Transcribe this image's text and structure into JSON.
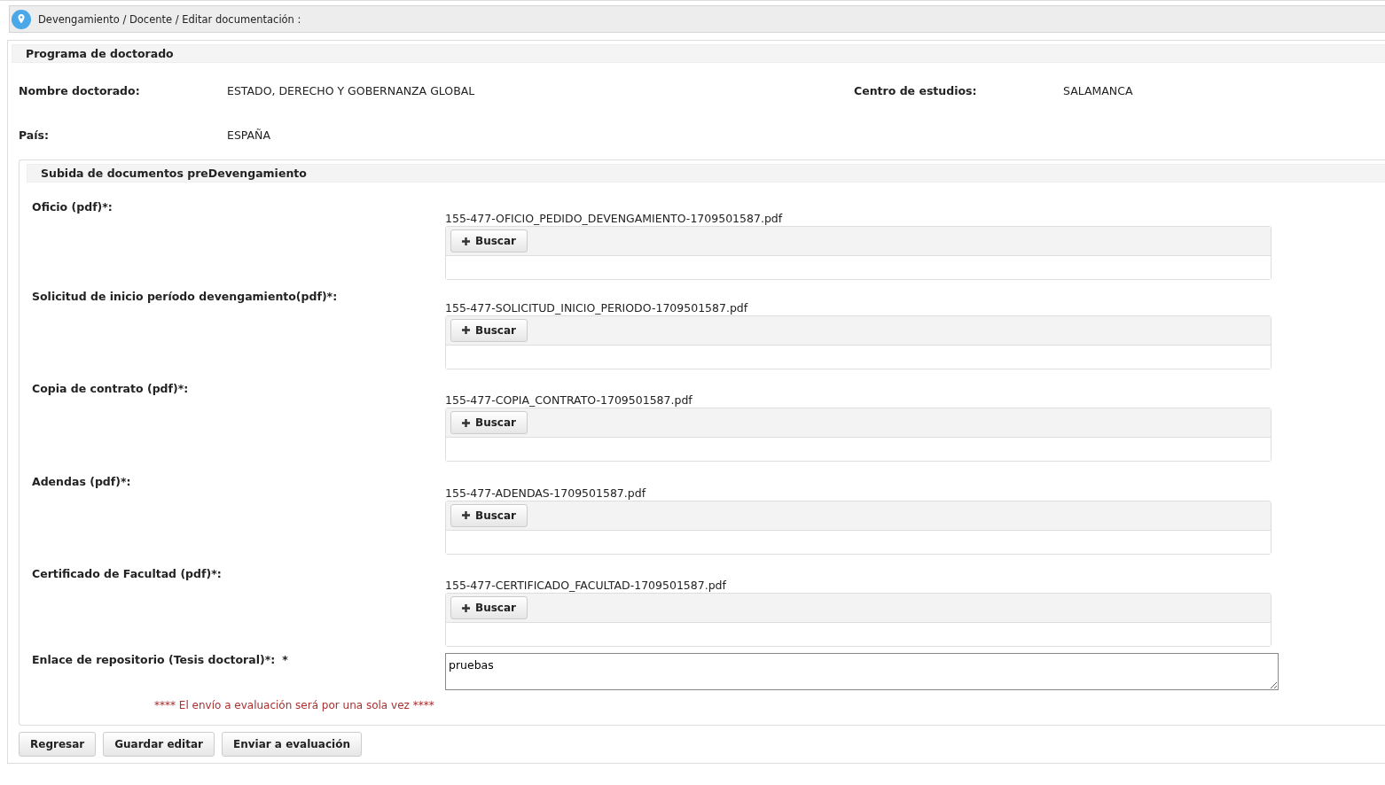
{
  "breadcrumb": "Devengamiento / Docente / Editar documentación :",
  "program_panel": {
    "title": "Programa de doctorado",
    "fields": [
      {
        "label": "Nombre doctorado:",
        "value": "ESTADO, DERECHO Y GOBERNANZA GLOBAL"
      },
      {
        "label": "Centro de estudios:",
        "value": "SALAMANCA"
      },
      {
        "label": "País:",
        "value": "ESPAÑA"
      }
    ]
  },
  "upload_panel": {
    "title": "Subida de documentos preDevengamiento",
    "documents": [
      {
        "label": "Oficio (pdf)*:",
        "file": "155-477-OFICIO_PEDIDO_DEVENGAMIENTO-1709501587.pdf",
        "button": "Buscar"
      },
      {
        "label": "Solicitud de inicio período devengamiento(pdf)*:",
        "file": "155-477-SOLICITUD_INICIO_PERIODO-1709501587.pdf",
        "button": "Buscar"
      },
      {
        "label": "Copia de contrato (pdf)*:",
        "file": "155-477-COPIA_CONTRATO-1709501587.pdf",
        "button": "Buscar"
      },
      {
        "label": "Adendas (pdf)*:",
        "file": "155-477-ADENDAS-1709501587.pdf",
        "button": "Buscar"
      },
      {
        "label": "Certificado de Facultad (pdf)*:",
        "file": "155-477-CERTIFICADO_FACULTAD-1709501587.pdf",
        "button": "Buscar"
      }
    ],
    "link": {
      "label": "Enlace de repositorio (Tesis doctoral)*:",
      "required_mark": "*",
      "value": "pruebas"
    },
    "notice": "**** El envío a evaluación será por una sola vez ****"
  },
  "buttons": [
    "Regresar",
    "Guardar editar",
    "Enviar a evaluación"
  ]
}
